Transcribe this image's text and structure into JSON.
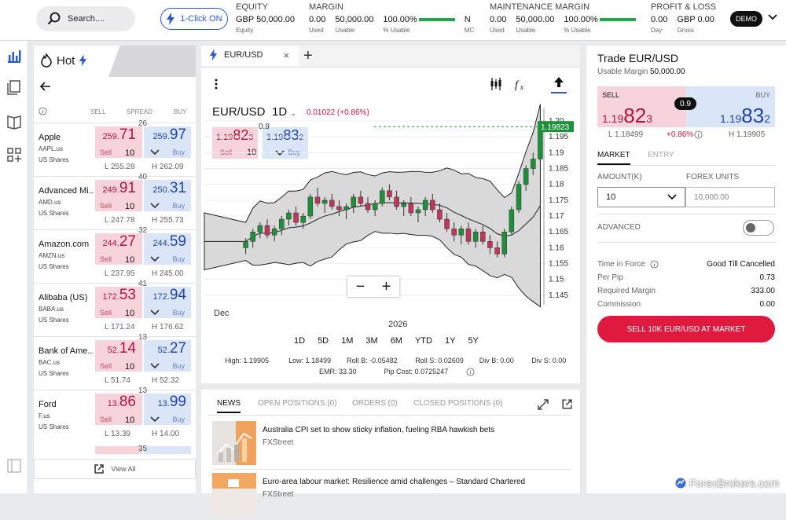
{
  "header": {
    "search_placeholder": "Search....",
    "one_click": "1-Click ON",
    "equity": {
      "title": "EQUITY",
      "value": "GBP 50,000.00",
      "label": "Equity"
    },
    "margin": {
      "title": "MARGIN",
      "used": "0.00",
      "used_label": "Used",
      "usable": "50,000.00",
      "usable_label": "Usable",
      "pct": "100.00%",
      "pct_label": "% Usable",
      "pct_value": 100,
      "mc": "N",
      "mc_label": "MC"
    },
    "maintenance": {
      "title": "MAINTENANCE MARGIN",
      "used": "0.00",
      "used_label": "Used",
      "usable": "50,000.00",
      "usable_label": "Usable",
      "pct": "100.00%",
      "pct_label": "% Usable",
      "pct_value": 100
    },
    "pl": {
      "title": "PROFIT & LOSS",
      "day": "0.00",
      "day_label": "Day",
      "gross": "GBP 0.00",
      "gross_label": "Gross"
    },
    "demo": "DEMO"
  },
  "watchlist": {
    "title": "Hot",
    "col_sell": "SELL",
    "col_spread": "SPREAD",
    "col_buy": "BUY",
    "sell_label": "Sell",
    "buy_label": "Buy",
    "items": [
      {
        "name": "Apple",
        "ticker": "AAPL.us",
        "type": "US Shares",
        "spread": "26",
        "sell_small": "259.",
        "sell_big": "71",
        "buy_small": "259.",
        "buy_big": "97",
        "qty": "10",
        "low": "L 255.28",
        "high": "H 262.09"
      },
      {
        "name": "Advanced Mi...",
        "ticker": "AMD.us",
        "type": "US Shares",
        "spread": "40",
        "sell_small": "249.",
        "sell_big": "91",
        "buy_small": "250.",
        "buy_big": "31",
        "qty": "10",
        "low": "L 247.78",
        "high": "H 255.73"
      },
      {
        "name": "Amazon.com",
        "ticker": "AMZN.us",
        "type": "US Shares",
        "spread": "32",
        "sell_small": "244.",
        "sell_big": "27",
        "buy_small": "244.",
        "buy_big": "59",
        "qty": "10",
        "low": "L 237.95",
        "high": "H 245.00"
      },
      {
        "name": "Alibaba (US)",
        "ticker": "BABA.us",
        "type": "US Shares",
        "spread": "41",
        "sell_small": "172.",
        "sell_big": "53",
        "buy_small": "172.",
        "buy_big": "94",
        "qty": "10",
        "low": "L 171.24",
        "high": "H 176.62"
      },
      {
        "name": "Bank of Ame...",
        "ticker": "BAC.us",
        "type": "US Shares",
        "spread": "13",
        "sell_small": "52.",
        "sell_big": "14",
        "buy_small": "52.",
        "buy_big": "27",
        "qty": "10",
        "low": "L 51.74",
        "high": "H 52.32"
      },
      {
        "name": "Ford",
        "ticker": "F.us",
        "type": "US Shares",
        "spread": "13",
        "sell_small": "13.",
        "sell_big": "86",
        "buy_small": "13.",
        "buy_big": "99",
        "qty": "10",
        "low": "L 13.39",
        "high": "H 14.00"
      }
    ],
    "next_spread": "35",
    "view_all": "View All"
  },
  "chart": {
    "tab": "EUR/USD",
    "pair": "EUR/USD",
    "timeframe": "1D",
    "change": "0.01022 (+0.86%)",
    "spread": "0.9",
    "sell_small": "1.19",
    "sell_big": "82",
    "sell_sup": "3",
    "buy_small": "1.19",
    "buy_big": "83",
    "buy_sup": "2",
    "qty": "10",
    "sell_label": "Sell",
    "buy_label": "Buy",
    "last_price": "1.19823",
    "x_labels": [
      "Dec",
      "2026"
    ],
    "y_ticks": [
      "1.20",
      "1.195",
      "1.19",
      "1.185",
      "1.18",
      "1.175",
      "1.17",
      "1.165",
      "1.16",
      "1.155",
      "1.15",
      "1.145"
    ],
    "timeframes": [
      "1D",
      "5D",
      "1M",
      "3M",
      "6M",
      "YTD",
      "1Y",
      "5Y"
    ],
    "stats": {
      "high": "High: 1.19905",
      "low": "Low: 1.18499",
      "rollb": "Roll B: -0.05482",
      "rolls": "Roll S: 0.02609",
      "divb": "Div B: 0.00",
      "divs": "Div S: 0.00",
      "emr": "EMR: 33.30",
      "pipcost": "Pip Cost: 0.0725247"
    }
  },
  "chart_data": {
    "type": "candlestick",
    "y_range": [
      1.142,
      1.2015
    ],
    "candles": [
      [
        1.16,
        1.163,
        1.158,
        1.162
      ],
      [
        1.162,
        1.166,
        1.16,
        1.165
      ],
      [
        1.165,
        1.168,
        1.163,
        1.167
      ],
      [
        1.167,
        1.169,
        1.163,
        1.164
      ],
      [
        1.164,
        1.167,
        1.162,
        1.166
      ],
      [
        1.166,
        1.17,
        1.164,
        1.169
      ],
      [
        1.169,
        1.172,
        1.167,
        1.171
      ],
      [
        1.171,
        1.173,
        1.167,
        1.168
      ],
      [
        1.168,
        1.171,
        1.166,
        1.17
      ],
      [
        1.17,
        1.177,
        1.169,
        1.176
      ],
      [
        1.176,
        1.179,
        1.173,
        1.174
      ],
      [
        1.174,
        1.176,
        1.171,
        1.175
      ],
      [
        1.175,
        1.177,
        1.172,
        1.173
      ],
      [
        1.173,
        1.175,
        1.17,
        1.172
      ],
      [
        1.172,
        1.174,
        1.169,
        1.173
      ],
      [
        1.173,
        1.177,
        1.171,
        1.176
      ],
      [
        1.176,
        1.178,
        1.173,
        1.174
      ],
      [
        1.174,
        1.176,
        1.171,
        1.172
      ],
      [
        1.172,
        1.175,
        1.17,
        1.174
      ],
      [
        1.174,
        1.179,
        1.173,
        1.178
      ],
      [
        1.178,
        1.18,
        1.175,
        1.176
      ],
      [
        1.176,
        1.178,
        1.172,
        1.173
      ],
      [
        1.173,
        1.175,
        1.17,
        1.174
      ],
      [
        1.174,
        1.176,
        1.17,
        1.171
      ],
      [
        1.171,
        1.173,
        1.168,
        1.172
      ],
      [
        1.172,
        1.176,
        1.17,
        1.175
      ],
      [
        1.175,
        1.177,
        1.171,
        1.172
      ],
      [
        1.172,
        1.174,
        1.168,
        1.169
      ],
      [
        1.169,
        1.171,
        1.165,
        1.166
      ],
      [
        1.166,
        1.168,
        1.162,
        1.164
      ],
      [
        1.164,
        1.167,
        1.161,
        1.166
      ],
      [
        1.166,
        1.168,
        1.161,
        1.162
      ],
      [
        1.162,
        1.166,
        1.16,
        1.165
      ],
      [
        1.165,
        1.167,
        1.161,
        1.162
      ],
      [
        1.162,
        1.164,
        1.158,
        1.16
      ],
      [
        1.16,
        1.162,
        1.157,
        1.158
      ],
      [
        1.158,
        1.166,
        1.157,
        1.165
      ],
      [
        1.165,
        1.173,
        1.164,
        1.172
      ],
      [
        1.172,
        1.181,
        1.171,
        1.18
      ],
      [
        1.18,
        1.186,
        1.178,
        1.185
      ],
      [
        1.185,
        1.19,
        1.183,
        1.188
      ],
      [
        1.188,
        1.199,
        1.187,
        1.198
      ]
    ]
  },
  "news": {
    "tabs": [
      "NEWS",
      "OPEN POSITIONS (0)",
      "ORDERS (0)",
      "CLOSED POSITIONS (0)"
    ],
    "items": [
      {
        "headline": "Australia CPI set to show sticky inflation, fueling RBA hawkish bets",
        "source": "FXStreet"
      },
      {
        "headline": "Euro-area labour market: Resilience amid challenges – Standard Chartered",
        "source": "FXStreet"
      }
    ]
  },
  "trade": {
    "title": "Trade EUR/USD",
    "usable_margin_label": "Usable Margin",
    "usable_margin": "50,000.00",
    "sell": "SELL",
    "buy": "BUY",
    "spread": "0.9",
    "sell_small": "1.19",
    "sell_big": "82",
    "sell_sup": "3",
    "buy_small": "1.19",
    "buy_big": "83",
    "buy_sup": "2",
    "low": "L 1.18499",
    "change": "+0.86%",
    "high": "H 1.19905",
    "tab_market": "MARKET",
    "tab_entry": "ENTRY",
    "amount_label": "AMOUNT(K)",
    "amount": "10",
    "units_label": "FOREX UNITS",
    "units": "10,000.00",
    "advanced": "ADVANCED",
    "tif_label": "Time in Force",
    "tif": "Good Till Cancelled",
    "perpip_label": "Per Pip",
    "perpip": "0.73",
    "reqmargin_label": "Required Margin",
    "reqmargin": "333.00",
    "commission_label": "Commission",
    "commission": "0.00",
    "button": "SELL 10K EUR/USD AT MARKET"
  },
  "watermark": "ForexBrokers.com",
  "colors": {
    "sell": "#b3143c",
    "buy": "#1f43a8",
    "up": "#1e8f3a",
    "down": "#c0355a",
    "accent": "#2b57d0"
  }
}
